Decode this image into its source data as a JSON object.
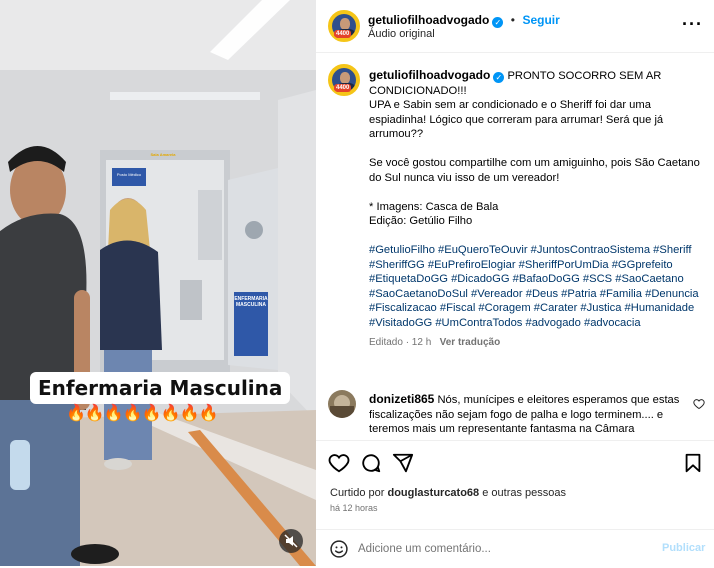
{
  "header": {
    "username": "getuliofilhoadvogado",
    "follow_label": "Seguir",
    "audio_label": "Áudio original",
    "more_icon": "more-horizontal-icon",
    "avatar_badge": "4400"
  },
  "video": {
    "overlay_title": "Enfermaria Masculina",
    "overlay_emojis": "🔥🔥🔥🔥🔥🔥🔥🔥",
    "door_sign": "ENFERMARIA MASCULINA",
    "wall_sign": "Posto Médico",
    "room_sign": "Sala Amarela",
    "mute_icon": "speaker-muted-icon"
  },
  "caption": {
    "username": "getuliofilhoadvogado",
    "text": "PRONTO SOCORRO SEM AR CONDICIONADO!!!\nUPA e Sabin sem ar condicionado e o Sheriff foi dar uma espiadinha! Lógico que correram para arrumar! Será que já arrumou??\n\nSe você gostou compartilhe com um amiguinho, pois São Caetano do Sul nunca viu isso de um vereador!\n\n* Imagens: Casca de Bala\nEdição: Getúlio Filho",
    "hashtags": "#GetulioFilho #EuQueroTeOuvir #JuntosContraoSistema #Sheriff #SheriffGG #EuPrefiroElogiar #SheriffPorUmDia #GGprefeito #EtiquetaDoGG #DicadoGG #BafaoDoGG #SCS #SaoCaetano #SaoCaetanoDoSul #Vereador #Deus #Patria #Familia #Denuncia #Fiscalizacao #Fiscal #Coragem #Carater #Justica #Humanidade #VisitadoGG #UmContraTodos #advogado #advocacia",
    "edited": "Editado · 12 h",
    "translate": "Ver tradução"
  },
  "comment": {
    "username": "donizeti865",
    "text": "Nós, munícipes e eleitores esperamos que estas fiscalizações não sejam fogo de palha e logo terminem.... e teremos mais um representante fantasma na Câmara",
    "like_icon": "heart-outline-icon"
  },
  "actions": {
    "icons": [
      "heart-icon",
      "comment-icon",
      "share-icon",
      "bookmark-icon"
    ],
    "liked_by_prefix": "Curtido por ",
    "liked_by_user": "douglasturcato68",
    "liked_by_suffix": " e outras pessoas",
    "time_ago": "há 12 horas"
  },
  "add_comment": {
    "placeholder": "Adicione um comentário...",
    "publish_label": "Publicar",
    "emoji_icon": "emoji-smile-icon"
  },
  "colors": {
    "accent": "#0095f6",
    "hashtag": "#00376b",
    "muted": "#737373",
    "publish_disabled": "#b2dffc"
  }
}
